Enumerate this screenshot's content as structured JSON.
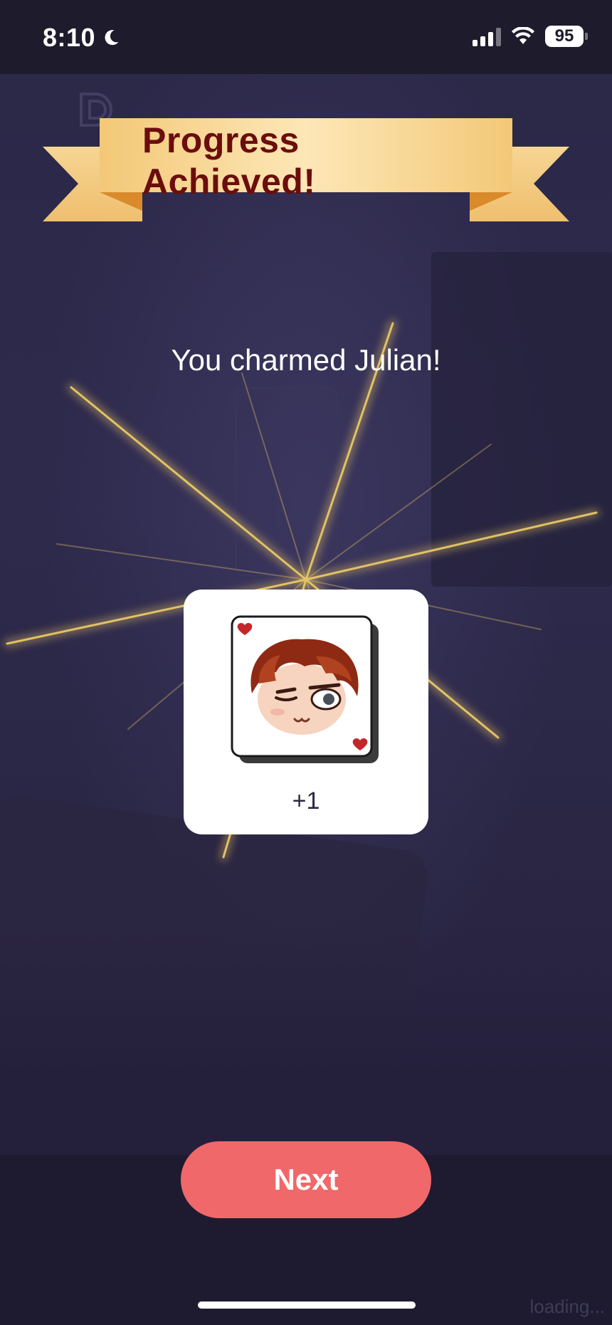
{
  "status_bar": {
    "time": "8:10",
    "battery": "95"
  },
  "banner": {
    "title": "Progress Achieved!"
  },
  "message": "You charmed Julian!",
  "reward": {
    "count": "+1"
  },
  "buttons": {
    "next_label": "Next"
  },
  "footer": {
    "loading": "loading..."
  },
  "colors": {
    "accent_button": "#f0686a",
    "banner_text": "#6b0d0d",
    "background": "#2c2848"
  }
}
